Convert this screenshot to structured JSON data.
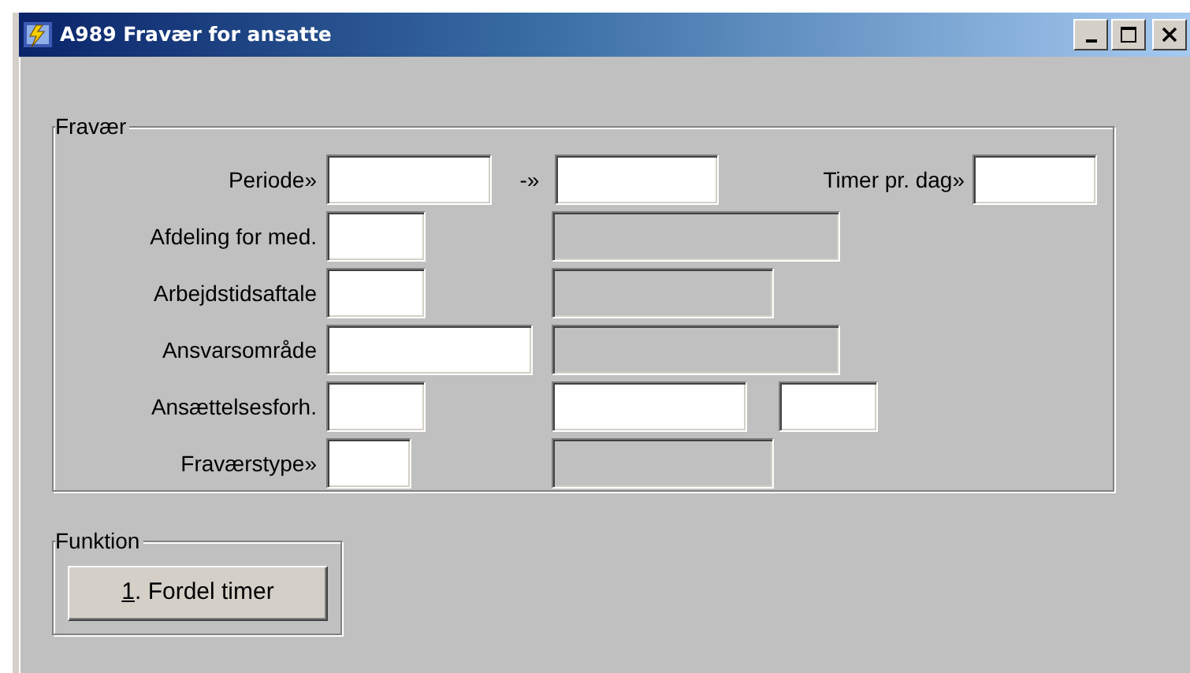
{
  "window": {
    "title": "A989 Fravær for ansatte"
  },
  "fravaer": {
    "legend": "Fravær",
    "rows": [
      {
        "items": [
          {
            "kind": "label",
            "text": "Periode»"
          },
          {
            "kind": "field",
            "disabled": false
          },
          {
            "kind": "label",
            "text": "-»"
          },
          {
            "kind": "field",
            "disabled": false
          },
          {
            "kind": "label",
            "text": "Timer pr. dag»"
          },
          {
            "kind": "field",
            "disabled": false
          }
        ]
      },
      {
        "items": [
          {
            "kind": "label",
            "text": "Afdeling for med."
          },
          {
            "kind": "field",
            "disabled": false
          },
          {
            "kind": "field",
            "disabled": true
          }
        ]
      },
      {
        "items": [
          {
            "kind": "label",
            "text": "Arbejdstidsaftale"
          },
          {
            "kind": "field",
            "disabled": false
          },
          {
            "kind": "field",
            "disabled": true
          }
        ]
      },
      {
        "items": [
          {
            "kind": "label",
            "text": "Ansvarsområde"
          },
          {
            "kind": "field",
            "disabled": false
          },
          {
            "kind": "field",
            "disabled": true
          }
        ]
      },
      {
        "items": [
          {
            "kind": "label",
            "text": "Ansættelsesforh."
          },
          {
            "kind": "field",
            "disabled": false
          },
          {
            "kind": "field",
            "disabled": false
          },
          {
            "kind": "field",
            "disabled": false
          }
        ]
      },
      {
        "items": [
          {
            "kind": "label",
            "text": "Fraværstype»"
          },
          {
            "kind": "field",
            "disabled": false
          },
          {
            "kind": "field",
            "disabled": true
          }
        ]
      }
    ]
  },
  "funktion": {
    "legend": "Funktion",
    "buttons": [
      {
        "label_parts": [
          {
            "text": "1",
            "underlined": true
          },
          {
            "text": ". Fordel timer",
            "underlined": false
          }
        ]
      }
    ]
  }
}
